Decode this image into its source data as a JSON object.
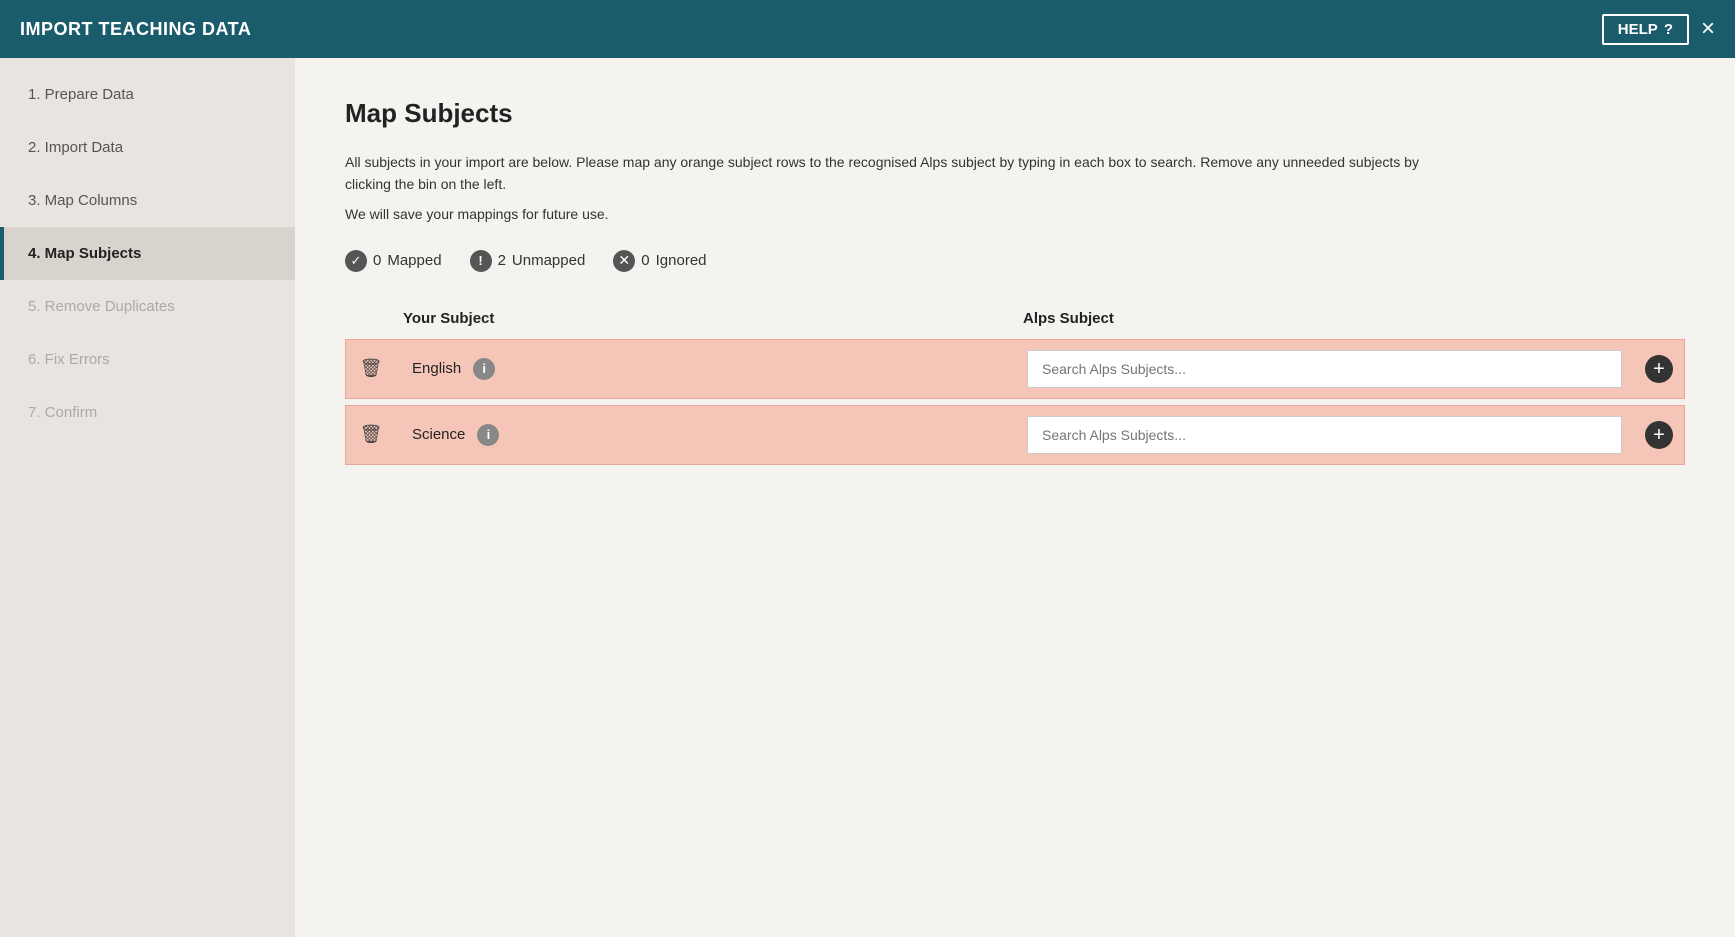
{
  "header": {
    "title": "IMPORT TEACHING DATA",
    "help_label": "HELP",
    "help_icon": "?",
    "close_icon": "×"
  },
  "sidebar": {
    "items": [
      {
        "id": "prepare-data",
        "label": "1. Prepare Data",
        "state": "inactive"
      },
      {
        "id": "import-data",
        "label": "2. Import Data",
        "state": "inactive"
      },
      {
        "id": "map-columns",
        "label": "3. Map Columns",
        "state": "inactive"
      },
      {
        "id": "map-subjects",
        "label": "4. Map Subjects",
        "state": "active"
      },
      {
        "id": "remove-duplicates",
        "label": "5. Remove Duplicates",
        "state": "disabled"
      },
      {
        "id": "fix-errors",
        "label": "6. Fix Errors",
        "state": "disabled"
      },
      {
        "id": "confirm",
        "label": "7. Confirm",
        "state": "disabled"
      }
    ]
  },
  "main": {
    "title": "Map Subjects",
    "description": "All subjects in your import are below. Please map any orange subject rows to the recognised Alps subject by typing in each box to search. Remove any unneeded subjects by clicking the bin on the left.",
    "sub_description": "We will save your mappings for future use.",
    "status": {
      "mapped_count": "0",
      "mapped_label": "Mapped",
      "unmapped_count": "2",
      "unmapped_label": "Unmapped",
      "ignored_count": "0",
      "ignored_label": "Ignored"
    },
    "table": {
      "col_your_subject": "Your Subject",
      "col_alps_subject": "Alps Subject",
      "rows": [
        {
          "id": "row-english",
          "subject_name": "English",
          "search_placeholder": "Search Alps Subjects..."
        },
        {
          "id": "row-science",
          "subject_name": "Science",
          "search_placeholder": "Search Alps Subjects..."
        }
      ]
    }
  }
}
